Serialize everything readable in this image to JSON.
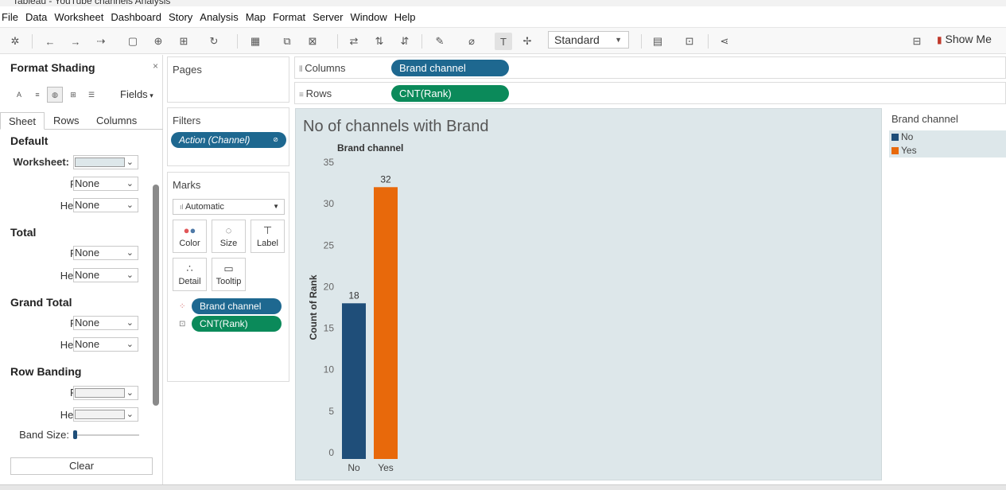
{
  "window": {
    "title": "Tableau - YouTube channels Analysis"
  },
  "menu": [
    "File",
    "Data",
    "Worksheet",
    "Dashboard",
    "Story",
    "Analysis",
    "Map",
    "Format",
    "Server",
    "Window",
    "Help"
  ],
  "toolbar": {
    "fit_mode": "Standard",
    "show_me": "Show Me"
  },
  "format_pane": {
    "title": "Format Shading",
    "close": "×",
    "fields_label": "Fields",
    "tabs": [
      "Sheet",
      "Rows",
      "Columns"
    ],
    "sections": {
      "default": {
        "title": "Default",
        "worksheet_label": "Worksheet:",
        "pane_label": "Pane:",
        "pane_value": "None",
        "header_label": "Header:",
        "header_value": "None"
      },
      "total": {
        "title": "Total",
        "pane_label": "Pane:",
        "pane_value": "None",
        "header_label": "Header:",
        "header_value": "None"
      },
      "grand_total": {
        "title": "Grand Total",
        "pane_label": "Pane:",
        "pane_value": "None",
        "header_label": "Header:",
        "header_value": "None"
      },
      "row_banding": {
        "title": "Row Banding",
        "pane_label": "Pane:",
        "header_label": "Header:",
        "band_size_label": "Band Size:"
      }
    },
    "clear_label": "Clear",
    "colors": {
      "worksheet_swatch": "#dde7ea"
    }
  },
  "pages_card": {
    "title": "Pages"
  },
  "filters_card": {
    "title": "Filters",
    "pill": "Action (Channel)"
  },
  "marks_card": {
    "title": "Marks",
    "mark_type": "Automatic",
    "buttons": [
      "Color",
      "Size",
      "Label",
      "Detail",
      "Tooltip"
    ],
    "pills": [
      "Brand channel",
      "CNT(Rank)"
    ]
  },
  "shelves": {
    "columns_label": "Columns",
    "columns_pill": "Brand channel",
    "rows_label": "Rows",
    "rows_pill": "CNT(Rank)"
  },
  "colors": {
    "blue_pill": "#1e6890",
    "green_pill": "#0b8a5a",
    "series_no": "#1f4e79",
    "series_yes": "#e8690b"
  },
  "chart_data": {
    "type": "bar",
    "title": "No of channels with Brand",
    "header": "Brand channel",
    "categories": [
      "No",
      "Yes"
    ],
    "values": [
      18,
      32
    ],
    "ylabel": "Count of Rank",
    "ylim": [
      0,
      35
    ],
    "yticks": [
      0,
      5,
      10,
      15,
      20,
      25,
      30,
      35
    ],
    "legend": {
      "title": "Brand channel",
      "items": [
        "No",
        "Yes"
      ],
      "position": "right"
    }
  }
}
